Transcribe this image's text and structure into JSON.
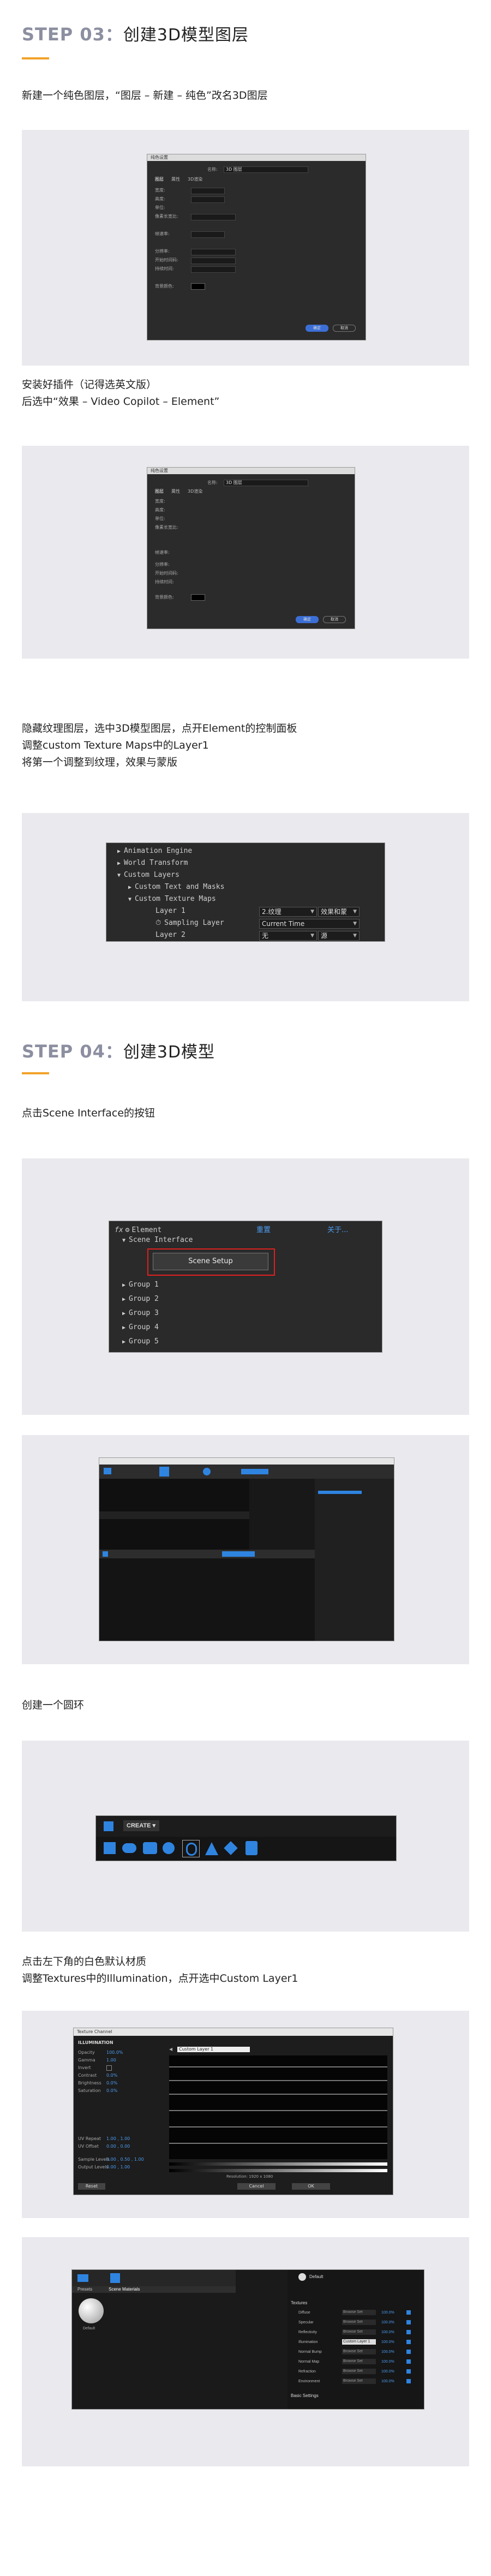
{
  "step03": {
    "num": "STEP 03",
    "colon": "：",
    "title": "创建3D模型图层",
    "para1": "新建一个纯色图层，“图层 – 新建 – 纯色”改名3D图层",
    "para2": "安装好插件（记得选英文版）\n后选中“效果 – Video Copilot – Element”",
    "para3": "隐藏纹理图层，选中3D模型图层，点开Element的控制面板\n调整custom Texture Maps中的Layer1\n将第一个调整到纹理，效果与蒙版"
  },
  "dialog": {
    "title": "纯色设置",
    "name_label": "名称:",
    "name_value": "3D 图层",
    "tabs": [
      "图层",
      "属性",
      "3D渲染"
    ],
    "rows": [
      "宽度:",
      "高度:",
      "单位:",
      "像素长宽比:",
      "",
      "帧速率:",
      "",
      "分辨率:",
      "开始时间码:",
      "持续时间:",
      "",
      "背景颜色:"
    ],
    "ok": "确定",
    "cancel": "取消"
  },
  "tree1": {
    "rows": [
      "Animation Engine",
      "World Transform",
      "Custom Layers",
      "Custom Text and Masks",
      "Custom Texture Maps"
    ],
    "layer1": "Layer 1",
    "layer1_sel": "2.纹理",
    "layer1_sel2": "效果和蒙",
    "sampling": "Sampling Layer",
    "current_time": "Current Time",
    "layer2": "Layer 2",
    "layer2_sel": "无",
    "layer2_sel2": "源"
  },
  "step04": {
    "num": "STEP 04",
    "colon": "：",
    "title": "创建3D模型",
    "para1": "点击Scene Interface的按钮",
    "para2": "创建一个圆环",
    "para3": "点击左下角的白色默认材质\n调整Textures中的Illumination，点开选中Custom Layer1"
  },
  "tree2": {
    "fx": "fx",
    "element": "Element",
    "reset": "重置",
    "about": "关于...",
    "scene_interface": "Scene Interface",
    "scene_setup": "Scene Setup",
    "groups": [
      "Group 1",
      "Group 2",
      "Group 3",
      "Group 4",
      "Group 5"
    ]
  },
  "create": {
    "label": "CREATE"
  },
  "texture": {
    "title": "Texture Channel",
    "channel": "ILLUMINATION",
    "labels": [
      "Opacity",
      "Gamma",
      "Invert",
      "Contrast",
      "Brightness",
      "Saturation"
    ],
    "values": [
      "100.0%",
      "1.00",
      "",
      "0.0%",
      "0.0%",
      "0.0%"
    ],
    "layer": "Custom Layer 1",
    "uv_repeat": "UV Repeat",
    "uv_offset": "UV Offset",
    "uv_repeat_val": "1.00 , 1.00",
    "uv_offset_val": "0.00 , 0.00",
    "sample_levels": "Sample Levels",
    "output_levels": "Output Levels",
    "sample_val": "0.00 , 0.50 , 1.00",
    "output_val": "0.00 , 1.00",
    "resolution": "Resolution: 1920 x 1080",
    "reset": "Reset",
    "cancel": "Cancel",
    "ok": "OK"
  },
  "materials": {
    "tab1": "Presets",
    "tab2": "Scene Materials",
    "default": "Default",
    "right_title": "Default",
    "textures": "Textures",
    "tex_rows": [
      "Diffuse",
      "Specular",
      "Reflectivity",
      "Illumination",
      "Normal Bump",
      "Normal Map",
      "Refraction",
      "Environment"
    ],
    "tex_vals": [
      "Browse Set",
      "Browse Set",
      "Browse Set",
      "Custom Layer 1",
      "Browse Set",
      "Browse Set",
      "Browse Set",
      "Browse Set"
    ],
    "tex_pct": [
      "100.0%",
      "100.0%",
      "100.0%",
      "100.0%",
      "100.0%",
      "100.0%",
      "100.0%",
      "100.0%"
    ],
    "basic": "Basic Settings"
  }
}
